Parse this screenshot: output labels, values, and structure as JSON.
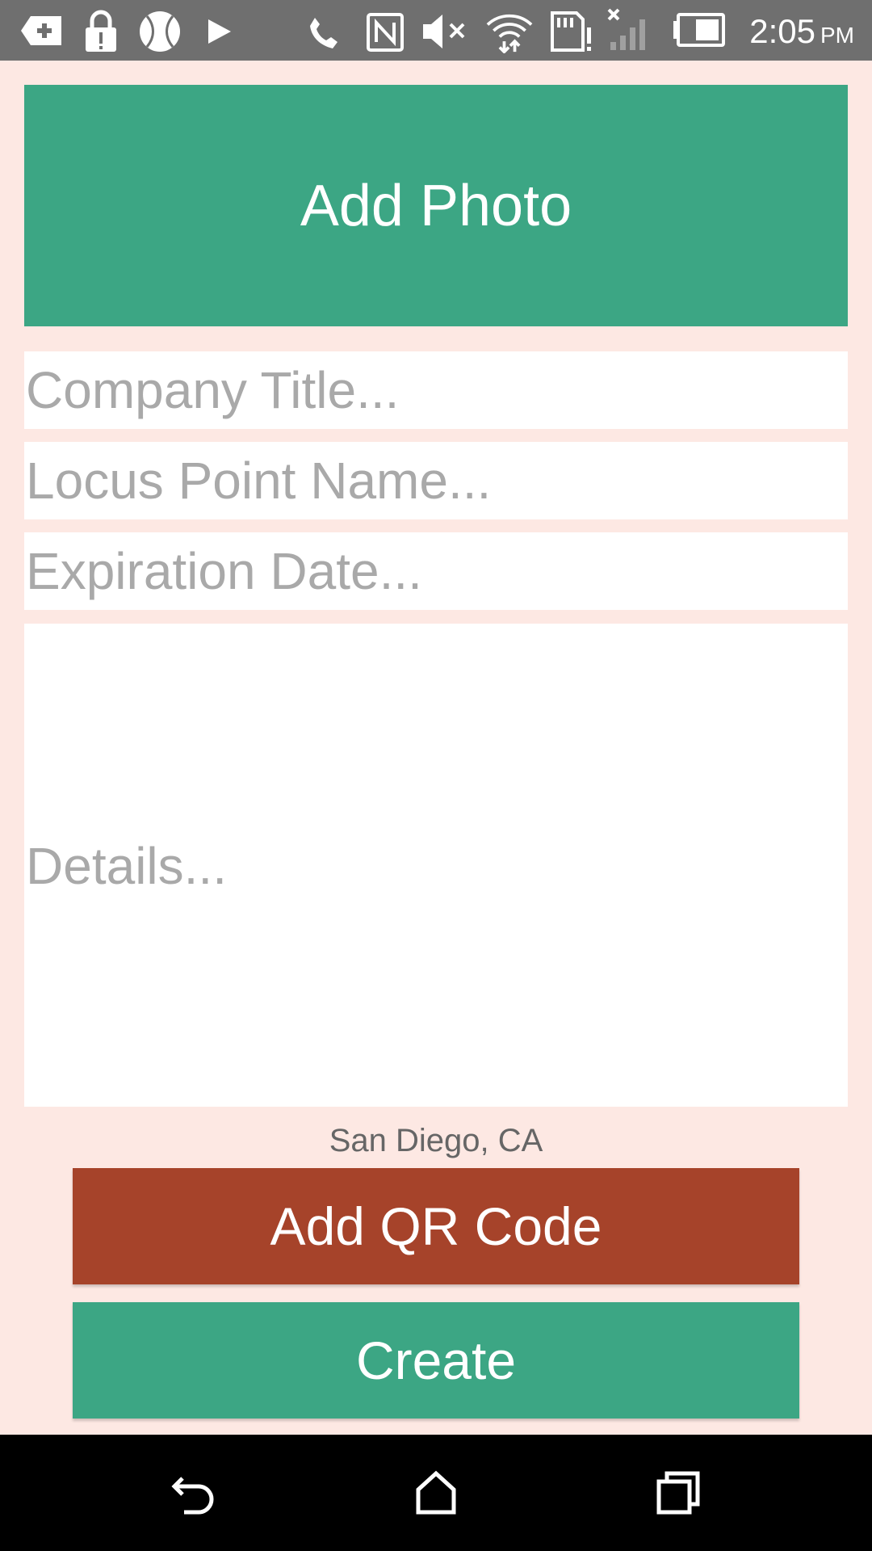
{
  "status_bar": {
    "time": "2:05",
    "ampm": "PM",
    "icons": [
      "add-notification-icon",
      "lock-icon",
      "baseball-icon",
      "play-store-icon",
      "phone-icon",
      "nfc-icon",
      "mute-icon",
      "wifi-icon",
      "sd-card-alert-icon",
      "no-signal-icon",
      "battery-icon"
    ]
  },
  "form": {
    "add_photo_label": "Add Photo",
    "company_title_placeholder": "Company Title...",
    "locus_point_name_placeholder": "Locus Point Name...",
    "expiration_date_placeholder": "Expiration Date...",
    "details_placeholder": "Details...",
    "location": "San Diego, CA",
    "add_qr_code_label": "Add QR Code",
    "create_label": "Create"
  },
  "nav_bar": {
    "icons": [
      "back-icon",
      "home-icon",
      "recents-icon"
    ]
  },
  "colors": {
    "background": "#fde8e3",
    "primary_green": "#3ca684",
    "qr_red": "#a6432a",
    "status_bar": "#6f6f6f",
    "nav_bar": "#000000",
    "placeholder": "#a9a9a9"
  }
}
